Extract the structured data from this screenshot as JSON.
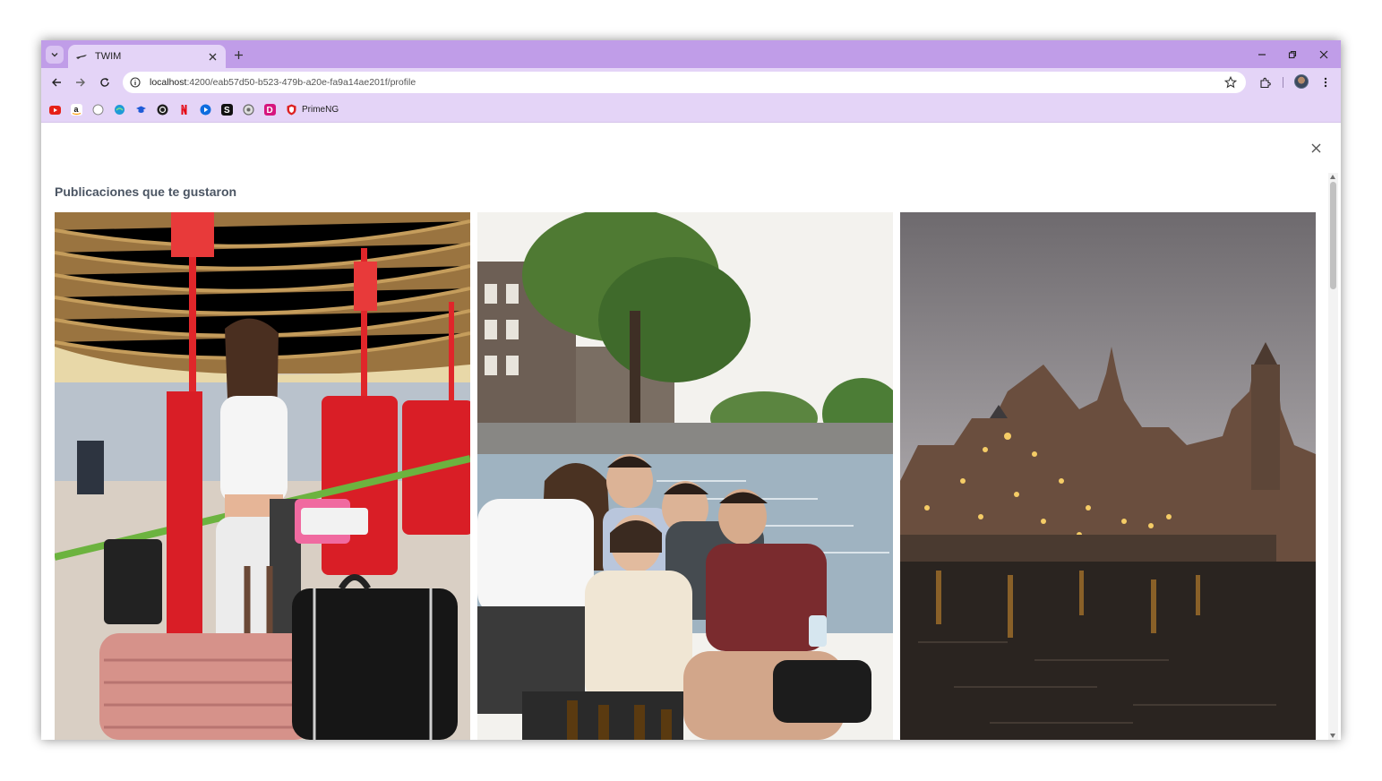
{
  "browser": {
    "tab_title": "TWIM",
    "url_host": "localhost",
    "url_path": ":4200/eab57d50-b523-479b-a20e-fa9a14ae201f/profile",
    "bookmarks": [
      {
        "icon": "youtube-icon",
        "color": "#e62117"
      },
      {
        "icon": "amazon-icon",
        "color": "#ffffff"
      },
      {
        "icon": "github-icon",
        "color": "#ffffff"
      },
      {
        "icon": "edge-icon",
        "color": "#1e9bd7"
      },
      {
        "icon": "graduation-cap-icon",
        "color": "#1e5bd7"
      },
      {
        "icon": "chatgpt-icon",
        "color": "#202020"
      },
      {
        "icon": "netflix-icon",
        "color": "#e50914"
      },
      {
        "icon": "play-icon",
        "color": "#0f6ddf"
      },
      {
        "icon": "s-icon",
        "color": "#111111"
      },
      {
        "icon": "openai-icon",
        "color": "#6b6b6b"
      },
      {
        "icon": "d-icon",
        "color": "#d6167e"
      },
      {
        "icon": "shield-icon",
        "color": "#dd2222"
      }
    ],
    "bookmark_label": "PrimeNG",
    "accent_color": "#c09de8"
  },
  "page": {
    "heading": "Publicaciones que te gustaron",
    "photos": [
      {
        "name": "airport-checkin-photo"
      },
      {
        "name": "canal-boat-friends-photo"
      },
      {
        "name": "canal-city-dusk-photo"
      }
    ]
  }
}
